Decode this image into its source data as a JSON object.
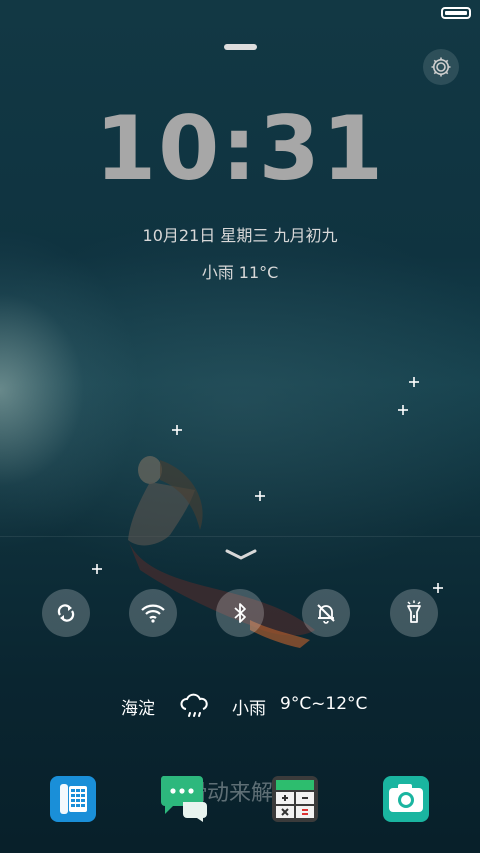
{
  "status": {
    "battery_level": 1.0
  },
  "lockscreen": {
    "time": "10:31",
    "date": "10月21日 星期三 九月初九",
    "weather_summary": "小雨 11°C"
  },
  "quick_toggles": [
    {
      "name": "sync",
      "icon": "sync-icon"
    },
    {
      "name": "wifi",
      "icon": "wifi-icon"
    },
    {
      "name": "bluetooth",
      "icon": "bluetooth-icon"
    },
    {
      "name": "silent",
      "icon": "bell-off-icon"
    },
    {
      "name": "flashlight",
      "icon": "flashlight-icon"
    }
  ],
  "weather_widget": {
    "city": "海淀",
    "icon": "rain-cloud-icon",
    "condition": "小雨",
    "temp_range": "9°C~12°C"
  },
  "swipe_hint": "滑动来解锁",
  "dock": [
    {
      "name": "phone",
      "icon": "phone-dialpad-icon",
      "color": "#1a8fd8"
    },
    {
      "name": "messages",
      "icon": "message-bubbles-icon",
      "color": "#2db87d"
    },
    {
      "name": "calculator",
      "icon": "calculator-icon",
      "color": "#3b3b3b"
    },
    {
      "name": "camera",
      "icon": "camera-icon",
      "color": "#1ab5a0"
    }
  ]
}
